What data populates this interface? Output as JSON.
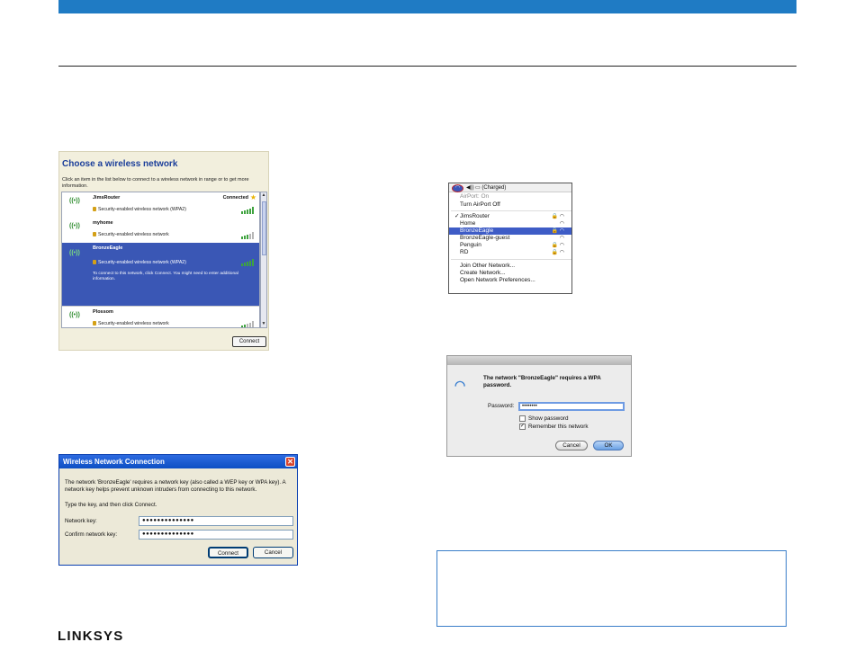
{
  "colors": {
    "accent": "#1f7bc4",
    "xp_blue": "#1b3e9a",
    "mac_select": "#3e5cc6"
  },
  "xp_chooser": {
    "title": "Choose a wireless network",
    "instruction": "Click an item in the list below to connect to a wireless network in range or to get more information.",
    "networks": [
      {
        "name": "JimsRouter",
        "security": "Security-enabled wireless network (WPA2)",
        "status": "Connected",
        "starred": true
      },
      {
        "name": "myhome",
        "security": "Security-enabled wireless network"
      },
      {
        "name": "BronzeEagle",
        "security": "Security-enabled wireless network (WPA2)",
        "description": "To connect to this network, click Connect. You might need to enter additional information.",
        "selected": true
      },
      {
        "name": "Plossom",
        "security": "Security-enabled wireless network"
      }
    ],
    "connect_label": "Connect"
  },
  "xp_dialog": {
    "title": "Wireless Network Connection",
    "close_glyph": "✕",
    "message": "The network 'BronzeEagle' requires a network key (also called a WEP key or WPA key). A network key helps prevent unknown intruders from connecting to this network.",
    "type_key": "Type the key, and then click Connect.",
    "network_key_label": "Network key:",
    "network_key_value": "●●●●●●●●●●●●●●",
    "confirm_key_label": "Confirm network key:",
    "confirm_key_value": "●●●●●●●●●●●●●●",
    "connect_label": "Connect",
    "cancel_label": "Cancel"
  },
  "mac_menu": {
    "status_battery": "(Charged)",
    "items": [
      {
        "label": "AirPort: On",
        "dim": true
      },
      {
        "label": "Turn AirPort Off"
      },
      {
        "label": "JimsRouter",
        "checked": true,
        "icons": "🔒 ◠"
      },
      {
        "label": "Home",
        "icons": "◠"
      },
      {
        "label": "BronzeEagle",
        "selected": true,
        "icons": "🔒 ◠"
      },
      {
        "label": "BronzeEagle-guest",
        "icons": "◠"
      },
      {
        "label": "Penguin",
        "icons": "🔒 ◠"
      },
      {
        "label": "RD",
        "icons": "🔒 ◠"
      },
      {
        "label": "Join Other Network..."
      },
      {
        "label": "Create Network..."
      },
      {
        "label": "Open Network Preferences..."
      }
    ]
  },
  "mac_dialog": {
    "message": "The network \"BronzeEagle\" requires a WPA password.",
    "password_label": "Password:",
    "password_value": "••••••••",
    "show_password_label": "Show password",
    "remember_label": "Remember this network",
    "cancel_label": "Cancel",
    "ok_label": "OK"
  },
  "brand": {
    "logo_text": "LINKSYS"
  }
}
